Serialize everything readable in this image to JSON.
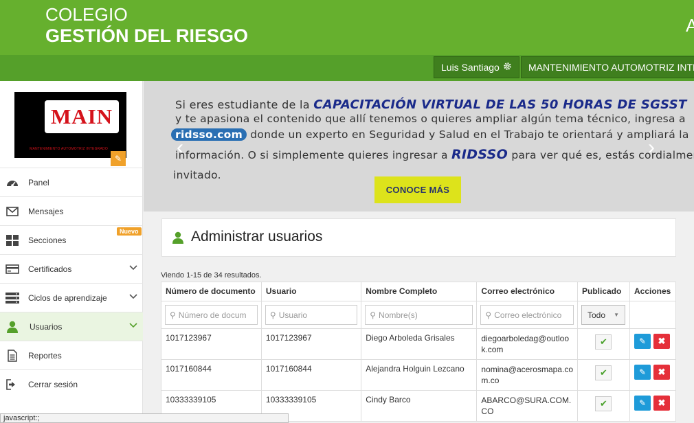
{
  "header": {
    "brand_line1": "COLEGIO",
    "brand_line2": "GESTIÓN DEL RIESGO",
    "brand_right": "A",
    "user_name": "Luis Santiago",
    "company_name": "MANTENIMIENTO AUTOMOTRIZ INTEGRADO",
    "accent_color": "#66b02e"
  },
  "sidebar": {
    "logo_text": "MAIN",
    "logo_subtext": "MANTENIMIENTO AUTOMOTRIZ INTEGRADO",
    "items": [
      {
        "label": "Panel",
        "icon": "dashboard-icon"
      },
      {
        "label": "Mensajes",
        "icon": "envelope-icon"
      },
      {
        "label": "Secciones",
        "icon": "grid-icon",
        "badge": "Nuevo"
      },
      {
        "label": "Certificados",
        "icon": "certificate-icon"
      },
      {
        "label": "Ciclos de aprendizaje",
        "icon": "server-icon"
      },
      {
        "label": "Usuarios",
        "icon": "user-icon"
      },
      {
        "label": "Reportes",
        "icon": "document-icon"
      },
      {
        "label": "Cerrar sesión",
        "icon": "sign-out-icon"
      }
    ]
  },
  "banner": {
    "line1_prefix": "Si eres estudiante de la",
    "line1_highlight": "CAPACITACIÓN VIRTUAL DE LAS 50 HORAS DE SGSST",
    "line2": "y te apasiona el contenido que allí tenemos o quieres ampliar algún tema técnico, ingresa a",
    "line3_pill": "ridsso.com",
    "line3_rest": "donde un experto en Seguridad y Salud en el Trabajo te orientará y ampliará la",
    "line4_prefix": "información. O si simplemente quieres ingresar a",
    "line4_highlight": "RIDSSO",
    "line4_rest": "para ver qué es, estás cordialmente",
    "line5": "invitado.",
    "button_label": "CONOCE MÁS",
    "prev_arrow": "‹",
    "next_arrow": "›"
  },
  "main": {
    "title": "Administrar usuarios",
    "summary": "Viendo 1-15 de 34 resultados.",
    "columns": [
      "Número de documento",
      "Usuario",
      "Nombre Completo",
      "Correo electrónico",
      "Publicado",
      "Acciones"
    ],
    "filters": {
      "documento_placeholder": "Número de docum",
      "usuario_placeholder": "Usuario",
      "nombre_placeholder": "Nombre(s)",
      "correo_placeholder": "Correo electrónico",
      "publicado_value": "Todo"
    },
    "rows": [
      {
        "documento": "1017123967",
        "usuario": "1017123967",
        "nombre": "Diego Arboleda Grisales",
        "correo_l1": "diegoarboledag@outloo",
        "correo_l2": "k.com"
      },
      {
        "documento": "1017160844",
        "usuario": "1017160844",
        "nombre": "Alejandra Holguin Lezcano",
        "correo_l1": "nomina@acerosmapa.co",
        "correo_l2": "m.co"
      },
      {
        "documento": "10333339105",
        "usuario": "10333339105",
        "nombre": "Cindy Barco",
        "correo_l1": "ABARCO@SURA.COM.",
        "correo_l2": "CO"
      }
    ]
  },
  "statusbar": "javascript:;"
}
